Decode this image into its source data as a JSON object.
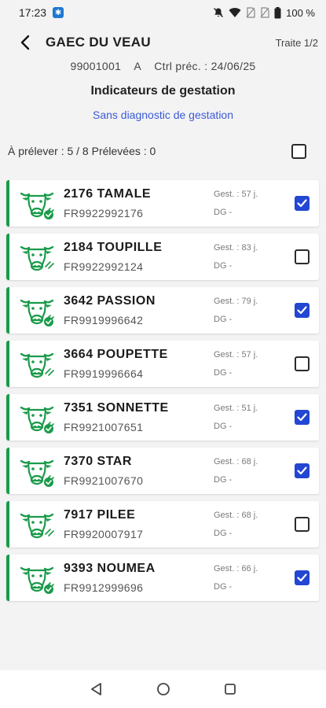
{
  "status_bar": {
    "time": "17:23",
    "battery": "100 %"
  },
  "header": {
    "title": "GAEC DU VEAU",
    "trait": "Traite 1/2"
  },
  "info": {
    "number": "99001001",
    "letter": "A",
    "ctrl": "Ctrl préc. : 24/06/25"
  },
  "section_title": "Indicateurs de gestation",
  "filter_label": "Sans diagnostic de gestation",
  "summary": {
    "text": "À prélever : 5 / 8 Prélevées : 0",
    "checked": false
  },
  "colors": {
    "accent_green": "#1a9b4a",
    "checkbox_blue": "#2346d3",
    "link_blue": "#3b5bd6"
  },
  "animals": [
    {
      "name": "2176 TAMALE",
      "id": "FR9922992176",
      "gest": "Gest. : 57 j.",
      "dg": "DG -",
      "checked": true,
      "badge": true
    },
    {
      "name": "2184 TOUPILLE",
      "id": "FR9922992124",
      "gest": "Gest. : 83 j.",
      "dg": "DG -",
      "checked": false,
      "badge": false
    },
    {
      "name": "3642 PASSION",
      "id": "FR9919996642",
      "gest": "Gest. : 79 j.",
      "dg": "DG -",
      "checked": true,
      "badge": true
    },
    {
      "name": "3664 POUPETTE",
      "id": "FR9919996664",
      "gest": "Gest. : 57 j.",
      "dg": "DG -",
      "checked": false,
      "badge": false
    },
    {
      "name": "7351 SONNETTE",
      "id": "FR9921007651",
      "gest": "Gest. : 51 j.",
      "dg": "DG -",
      "checked": true,
      "badge": true
    },
    {
      "name": "7370 STAR",
      "id": "FR9921007670",
      "gest": "Gest. : 68 j.",
      "dg": "DG -",
      "checked": true,
      "badge": true
    },
    {
      "name": "7917 PILEE",
      "id": "FR9920007917",
      "gest": "Gest. : 68 j.",
      "dg": "DG -",
      "checked": false,
      "badge": false
    },
    {
      "name": "9393 NOUMEA",
      "id": "FR9912999696",
      "gest": "Gest. : 66 j.",
      "dg": "DG -",
      "checked": true,
      "badge": true
    }
  ]
}
